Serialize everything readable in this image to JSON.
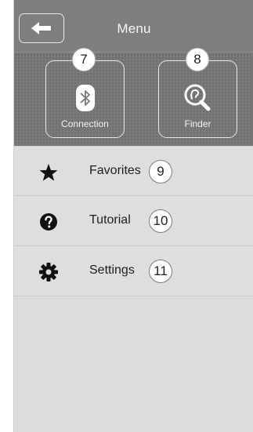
{
  "header": {
    "title": "Menu",
    "back_icon": "back-arrow-icon"
  },
  "tiles": [
    {
      "label": "Connection",
      "badge": "7",
      "icon": "bluetooth-icon"
    },
    {
      "label": "Finder",
      "badge": "8",
      "icon": "finder-search-icon"
    }
  ],
  "menu": [
    {
      "label": "Favorites",
      "badge": "9",
      "icon": "star-icon"
    },
    {
      "label": "Tutorial",
      "badge": "10",
      "icon": "help-icon"
    },
    {
      "label": "Settings",
      "badge": "11",
      "icon": "gear-icon"
    }
  ]
}
